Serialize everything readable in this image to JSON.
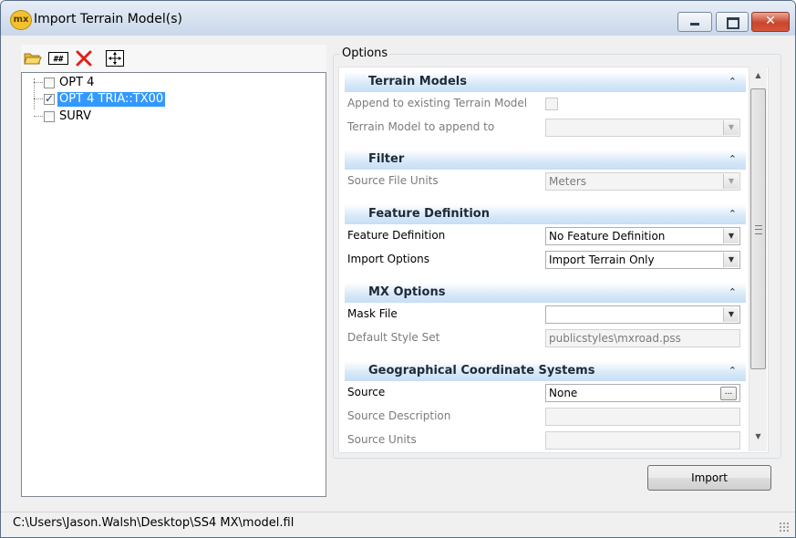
{
  "window": {
    "title": "Import Terrain Model(s)",
    "icon_text": "mx",
    "close_glyph": "✕"
  },
  "toolbar": {
    "icons": [
      "open-folder-icon",
      "grid-icon",
      "delete-icon",
      "move-icon"
    ]
  },
  "tree": {
    "items": [
      {
        "label": "OPT 4",
        "checked": false,
        "selected": false
      },
      {
        "label": "OPT 4 TRIA::TX00",
        "checked": true,
        "selected": true
      },
      {
        "label": "SURV",
        "checked": false,
        "selected": false
      }
    ]
  },
  "options": {
    "legend": "Options",
    "sections": [
      {
        "title": "Terrain Models",
        "rows": [
          {
            "label": "Append to existing Terrain Model",
            "type": "checkbox",
            "value": "",
            "disabled": true
          },
          {
            "label": "Terrain Model to append to",
            "type": "dropdown",
            "value": "",
            "disabled": true
          }
        ]
      },
      {
        "title": "Filter",
        "rows": [
          {
            "label": "Source File Units",
            "type": "dropdown",
            "value": "Meters",
            "disabled": true
          }
        ]
      },
      {
        "title": "Feature Definition",
        "rows": [
          {
            "label": "Feature Definition",
            "type": "dropdown",
            "value": "No Feature Definition",
            "disabled": false
          },
          {
            "label": "Import Options",
            "type": "dropdown",
            "value": "Import Terrain Only",
            "disabled": false
          }
        ]
      },
      {
        "title": "MX Options",
        "rows": [
          {
            "label": "Mask File",
            "type": "dropdown",
            "value": "",
            "disabled": false
          },
          {
            "label": "Default Style Set",
            "type": "text",
            "value": "publicstyles\\mxroad.pss",
            "disabled": true
          }
        ]
      },
      {
        "title": "Geographical Coordinate Systems",
        "rows": [
          {
            "label": "Source",
            "type": "ellipsis",
            "value": "None",
            "disabled": false
          },
          {
            "label": "Source Description",
            "type": "text",
            "value": "",
            "disabled": true
          },
          {
            "label": "Source Units",
            "type": "text",
            "value": "",
            "disabled": true
          }
        ]
      }
    ]
  },
  "buttons": {
    "import_label": "Import",
    "ellipsis_label": "..."
  },
  "status": {
    "path": "C:\\Users\\Jason.Walsh\\Desktop\\SS4 MX\\model.fil"
  },
  "glyphs": {
    "dropdown": "▼",
    "collapse": "⌃",
    "scroll_up": "▲",
    "scroll_down": "▼"
  }
}
